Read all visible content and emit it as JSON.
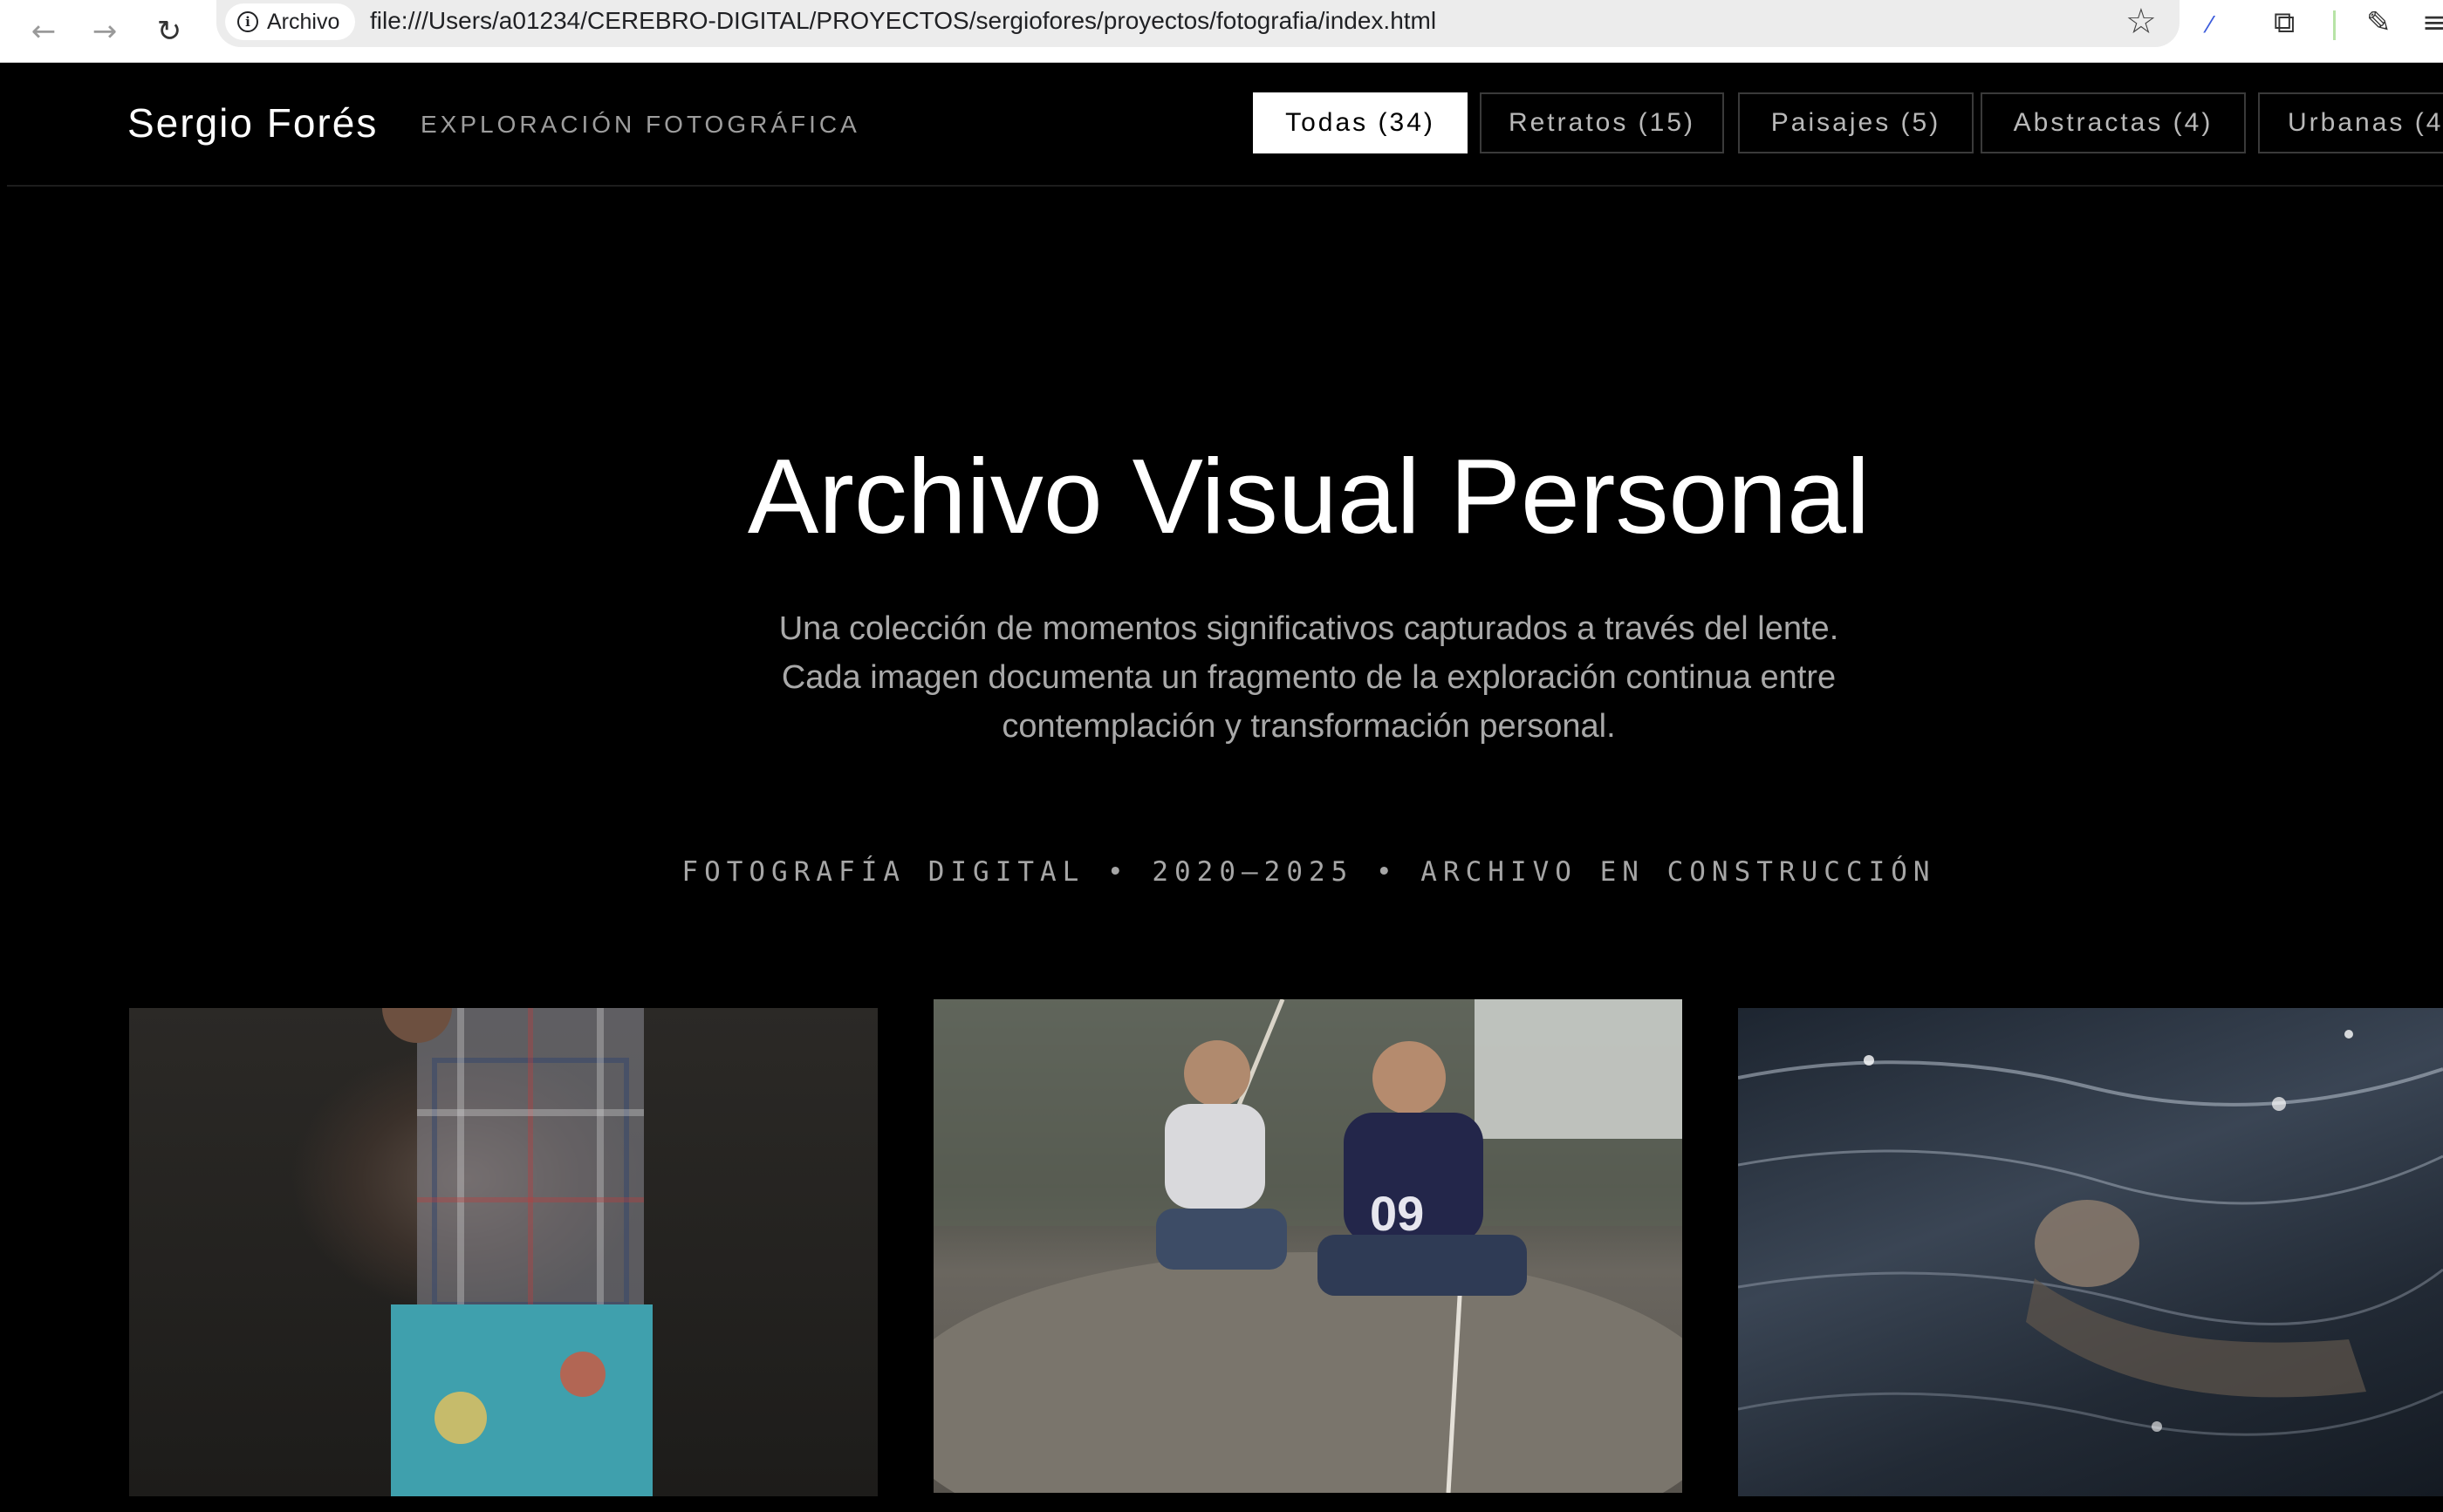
{
  "browser": {
    "site_chip_label": "Archivo",
    "url": "file:///Users/a01234/CEREBRO-DIGITAL/PROYECTOS/sergiofores/proyectos/fotografia/index.html"
  },
  "header": {
    "brand_name": "Sergio Forés",
    "tagline": "EXPLORACIÓN FOTOGRÁFICA",
    "filters": [
      {
        "label": "Todas (34)",
        "active": true
      },
      {
        "label": "Retratos (15)",
        "active": false
      },
      {
        "label": "Paisajes (5)",
        "active": false
      },
      {
        "label": "Abstractas (4)",
        "active": false
      },
      {
        "label": "Urbanas (4",
        "active": false
      }
    ]
  },
  "hero": {
    "title": "Archivo Visual Personal",
    "description": "Una colección de momentos significativos capturados a través del lente. Cada imagen documenta un fragmento de la exploración continua entre contemplación y transformación personal.",
    "meta": "FOTOGRAFÍA DIGITAL • 2020—2025 • ARCHIVO EN CONSTRUCCIÓN"
  },
  "gallery": {
    "photos": [
      {
        "subject": "child in plaid shirt against dark chalkboard"
      },
      {
        "subject": "two boys sitting on a rock with sticks"
      },
      {
        "subject": "person floating in dark water"
      }
    ]
  },
  "icons": {
    "back": "back-arrow-icon",
    "forward": "forward-arrow-icon",
    "reload": "reload-icon",
    "info": "info-icon",
    "star": "star-icon",
    "extensions": "puzzle-icon"
  }
}
